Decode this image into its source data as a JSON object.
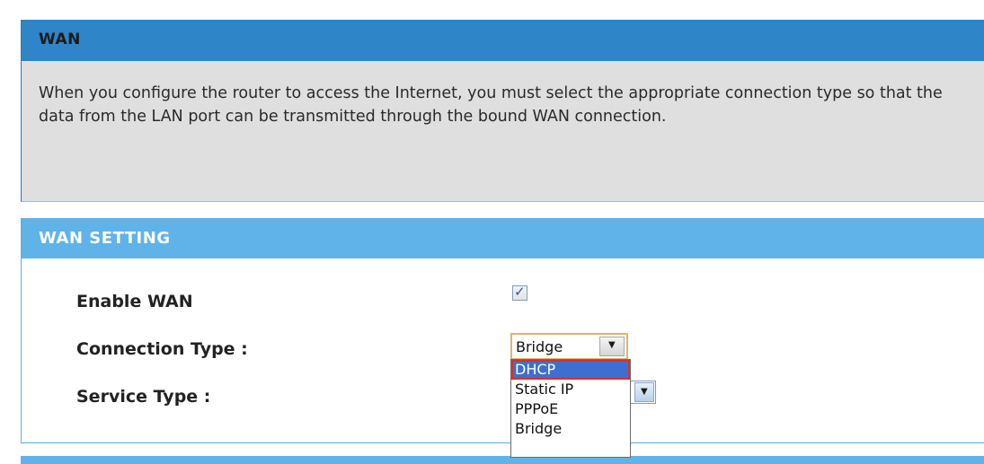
{
  "wan": {
    "title": "WAN",
    "description": "When you configure the router to access the Internet, you must select the appropriate connection type so that the data from the LAN port can be transmitted through the bound WAN connection."
  },
  "wan_setting": {
    "title": "WAN SETTING",
    "enable_wan_label": "Enable WAN",
    "enable_wan_checked": true,
    "checkbox_mark": "✓",
    "connection_type_label": "Connection Type :",
    "connection_type_value": "Bridge",
    "service_type_label": "Service Type :",
    "dropdown_arrow": "▼",
    "connection_options": [
      "DHCP",
      "Static IP",
      "PPPoE",
      "Bridge"
    ],
    "highlighted_option": "DHCP"
  },
  "colors": {
    "wan_header": "#2e85c7",
    "setting_header": "#5fb3e8",
    "highlight_outline": "#d9302c",
    "selected_option_bg": "#3d6fd0"
  }
}
